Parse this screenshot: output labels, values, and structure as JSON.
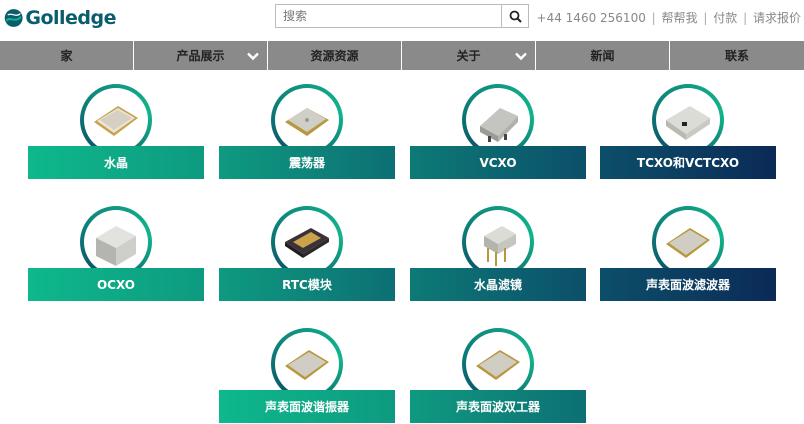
{
  "brand": {
    "name": "Golledge"
  },
  "search": {
    "placeholder": "搜索"
  },
  "top_links": {
    "phone": "+44 1460 256100",
    "help": "帮帮我",
    "pay": "付款",
    "quote": "请求报价",
    "separator": "|"
  },
  "nav": {
    "items": [
      {
        "label": "家"
      },
      {
        "label": "产品展示"
      },
      {
        "label": "资源资源"
      },
      {
        "label": "关于"
      },
      {
        "label": "新闻"
      },
      {
        "label": "联系"
      }
    ]
  },
  "products": [
    {
      "label": "水晶",
      "icon": "smd-crystal-icon"
    },
    {
      "label": "震荡器",
      "icon": "oscillator-icon"
    },
    {
      "label": "VCXO",
      "icon": "vcxo-icon"
    },
    {
      "label": "TCXO和VCTCXO",
      "icon": "tcxo-icon"
    },
    {
      "label": "OCXO",
      "icon": "ocxo-icon"
    },
    {
      "label": "RTC模块",
      "icon": "rtc-module-icon"
    },
    {
      "label": "水晶滤镜",
      "icon": "crystal-filter-icon"
    },
    {
      "label": "声表面波滤波器",
      "icon": "saw-filter-icon"
    },
    {
      "label": "声表面波谐振器",
      "icon": "saw-resonator-icon"
    },
    {
      "label": "声表面波双工器",
      "icon": "saw-duplexer-icon"
    }
  ],
  "colors": {
    "nav_bg": "#8a8a8a",
    "brand": "#0a5d6d",
    "tile_start": "#0eb88c",
    "tile_end": "#0b2a56"
  }
}
